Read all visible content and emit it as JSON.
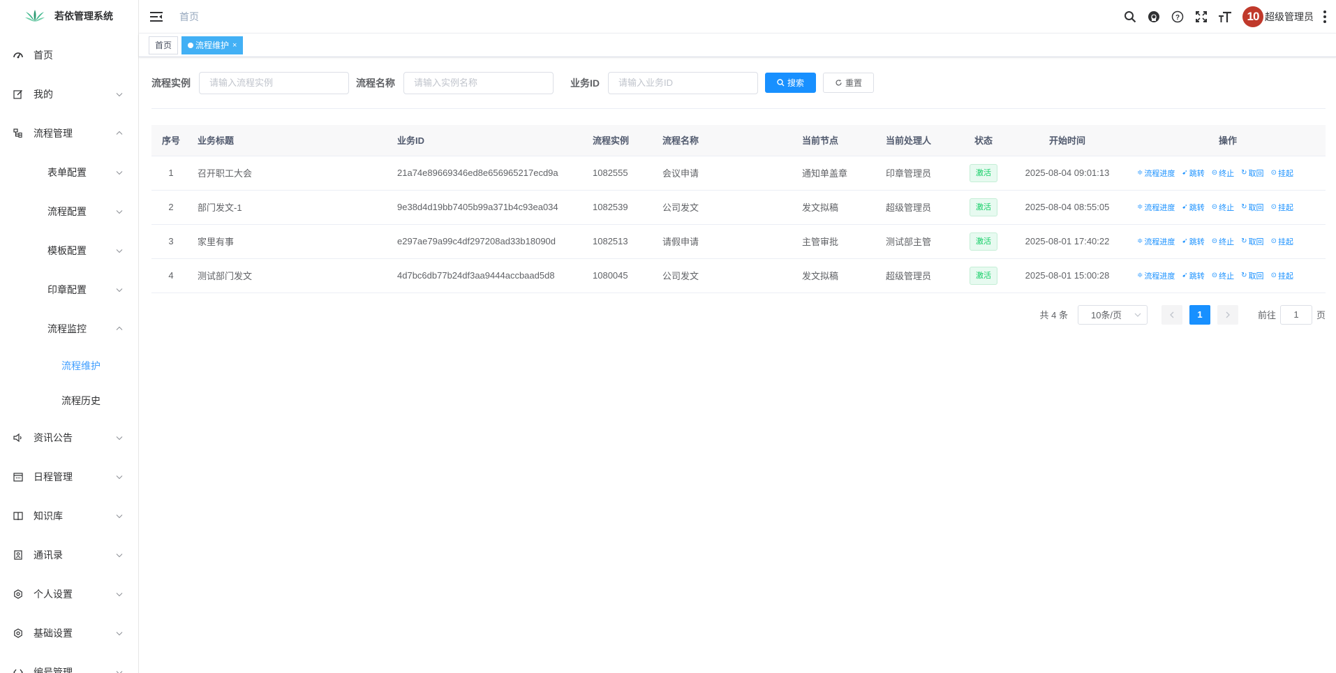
{
  "app": {
    "title": "若依管理系统"
  },
  "sidebar": {
    "items": [
      {
        "label": "首页",
        "icon": "dashboard-icon",
        "level": 0,
        "has_arrow": false
      },
      {
        "label": "我的",
        "icon": "edit-icon",
        "level": 0,
        "has_arrow": true,
        "expanded": false
      },
      {
        "label": "流程管理",
        "icon": "tree-icon",
        "level": 0,
        "has_arrow": true,
        "expanded": true
      },
      {
        "label": "表单配置",
        "level": 1,
        "has_arrow": true,
        "expanded": false
      },
      {
        "label": "流程配置",
        "level": 1,
        "has_arrow": true,
        "expanded": false
      },
      {
        "label": "模板配置",
        "level": 1,
        "has_arrow": true,
        "expanded": false
      },
      {
        "label": "印章配置",
        "level": 1,
        "has_arrow": true,
        "expanded": false
      },
      {
        "label": "流程监控",
        "level": 1,
        "has_arrow": true,
        "expanded": true
      },
      {
        "label": "流程维护",
        "level": 2,
        "has_arrow": false,
        "active": true
      },
      {
        "label": "流程历史",
        "level": 2,
        "has_arrow": false
      },
      {
        "label": "资讯公告",
        "icon": "speaker-icon",
        "level": 0,
        "has_arrow": true,
        "expanded": false
      },
      {
        "label": "日程管理",
        "icon": "calendar-icon",
        "level": 0,
        "has_arrow": true,
        "expanded": false
      },
      {
        "label": "知识库",
        "icon": "book-icon",
        "level": 0,
        "has_arrow": true,
        "expanded": false
      },
      {
        "label": "通讯录",
        "icon": "contacts-icon",
        "level": 0,
        "has_arrow": true,
        "expanded": false
      },
      {
        "label": "个人设置",
        "icon": "gear-icon",
        "level": 0,
        "has_arrow": true,
        "expanded": false
      },
      {
        "label": "基础设置",
        "icon": "gear-icon",
        "level": 0,
        "has_arrow": true,
        "expanded": false
      },
      {
        "label": "编号管理",
        "icon": "code-icon",
        "level": 0,
        "has_arrow": true,
        "expanded": false
      }
    ]
  },
  "header": {
    "breadcrumb": "首页",
    "avatar_text": "10",
    "user_name": "超级管理员"
  },
  "tags": [
    {
      "label": "首页",
      "active": false
    },
    {
      "label": "流程维护",
      "active": true,
      "close": "×"
    }
  ],
  "search": {
    "instance_label": "流程实例",
    "instance_placeholder": "请输入流程实例",
    "name_label": "流程名称",
    "name_placeholder": "请输入实例名称",
    "biz_label": "业务ID",
    "biz_placeholder": "请输入业务ID",
    "search_button": "搜索",
    "reset_button": "重置"
  },
  "table": {
    "headers": [
      "序号",
      "业务标题",
      "业务ID",
      "流程实例",
      "流程名称",
      "当前节点",
      "当前处理人",
      "状态",
      "开始时间",
      "操作"
    ],
    "rows": [
      {
        "no": "1",
        "title": "召开职工大会",
        "biz_id": "21a74e89669346ed8e656965217ecd9a",
        "instance": "1082555",
        "name": "会议申请",
        "node": "通知单盖章",
        "handler": "印章管理员",
        "status": "激活",
        "start": "2025-08-04 09:01:13"
      },
      {
        "no": "2",
        "title": "部门发文-1",
        "biz_id": "9e38d4d19bb7405b99a371b4c93ea034",
        "instance": "1082539",
        "name": "公司发文",
        "node": "发文拟稿",
        "handler": "超级管理员",
        "status": "激活",
        "start": "2025-08-04 08:55:05"
      },
      {
        "no": "3",
        "title": "家里有事",
        "biz_id": "e297ae79a99c4df297208ad33b18090d",
        "instance": "1082513",
        "name": "请假申请",
        "node": "主管审批",
        "handler": "测试部主管",
        "status": "激活",
        "start": "2025-08-01 17:40:22"
      },
      {
        "no": "4",
        "title": "测试部门发文",
        "biz_id": "4d7bc6db77b24df3aa9444accbaad5d8",
        "instance": "1080045",
        "name": "公司发文",
        "node": "发文拟稿",
        "handler": "超级管理员",
        "status": "激活",
        "start": "2025-08-01 15:00:28"
      }
    ],
    "ops": [
      "流程进度",
      "跳转",
      "终止",
      "取回",
      "挂起"
    ]
  },
  "pagination": {
    "total": "共 4 条",
    "page_size": "10条/页",
    "current_page": "1",
    "goto_label": "前往",
    "goto_value": "1",
    "page_suffix": "页"
  },
  "colors": {
    "primary": "#1890ff",
    "active_tag": "#42b0f5",
    "status_green": "#13ce66"
  }
}
